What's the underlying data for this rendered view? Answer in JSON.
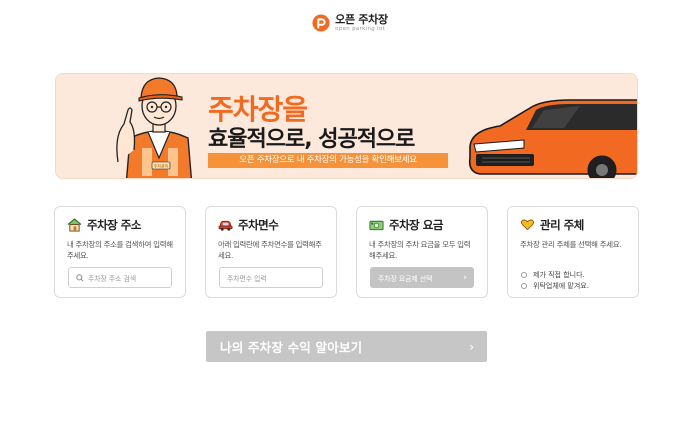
{
  "header": {
    "logo_title": "오픈 주차장",
    "logo_sub": "open parking lot"
  },
  "banner": {
    "headline": "주차장을",
    "subheadline": "효율적으로, 성공적으로",
    "pill_text": "오픈 주차장으로 내 주차장의 가능성을 확인해보세요",
    "vest_text": "주차관리"
  },
  "cards": {
    "address": {
      "title": "주차장 주소",
      "desc": "내 주차장의 주소를 검색하여 입력해주세요.",
      "input_placeholder": "주차장 주소 검색"
    },
    "spaces": {
      "title": "주차면수",
      "desc": "아래 입력란에 주차면수를 입력해주세요.",
      "input_placeholder": "주차면수 입력"
    },
    "fee": {
      "title": "주차장 요금",
      "desc": "내 주차장의 주차 요금을 모두 입력해주세요.",
      "button_label": "주차장 요금제 선택"
    },
    "manager": {
      "title": "관리 주체",
      "desc": "주차장 관리 주체를 선택해 주세요.",
      "options": [
        "제가 직접 합니다.",
        "위탁업체에 맡겨요."
      ]
    }
  },
  "cta": {
    "label": "나의 주차장 수익 알아보기",
    "arrow": "›"
  },
  "colors": {
    "brand_orange": "#f26a21",
    "banner_bg": "#fde9dc",
    "disabled_gray": "#c6c6c6"
  },
  "icons": {
    "logo": "parking-pin-logo-icon",
    "address": "house-icon",
    "spaces": "car-icon",
    "fee": "cash-icon",
    "manager": "heart-hand-icon",
    "search": "search-icon",
    "chevron": "chevron-right-icon"
  }
}
